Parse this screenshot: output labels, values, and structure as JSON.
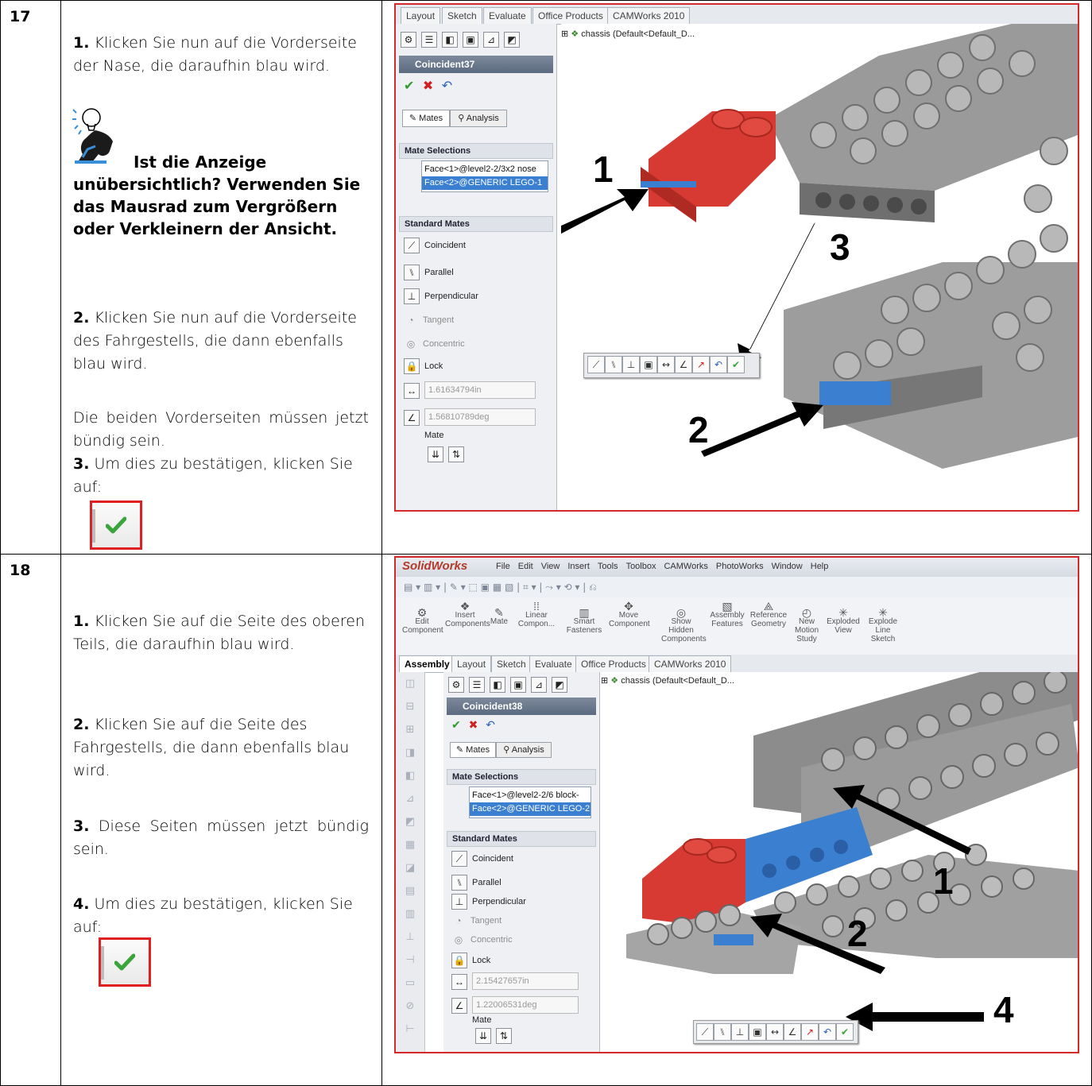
{
  "steps": [
    {
      "number": "17",
      "p1_num": "1.",
      "p1_text": " Klicken Sie nun auf die Vorderseite der Nase, die daraufhin blau wird.",
      "tip": "Ist die Anzeige unübersichtlich? Verwenden Sie das Mausrad zum Vergrößern oder Verkleinern der Ansicht.",
      "p2_num": "2.",
      "p2_text": " Klicken Sie nun auf die Vorderseite des Fahrgestells, die dann ebenfalls blau wird.",
      "p3_text": "Die beiden Vorderseiten müssen jetzt bündig sein.",
      "p4_num": "3.",
      "p4_text": " Um dies zu bestätigen, klicken Sie auf:"
    },
    {
      "number": "18",
      "p1_num": "1.",
      "p1_text": " Klicken Sie auf die Seite des oberen Teils, die daraufhin blau wird.",
      "p2_num": "2.",
      "p2_text": " Klicken Sie auf die Seite des Fahrgestells, die dann ebenfalls blau wird.",
      "p3_num": "3.",
      "p3_text": " Diese Seiten müssen jetzt bündig sein.",
      "p4_num": "4.",
      "p4_text": " Um dies zu bestätigen, klicken Sie auf:"
    }
  ],
  "shot1": {
    "tabs": [
      "Layout",
      "Sketch",
      "Evaluate",
      "Office Products",
      "CAMWorks 2010"
    ],
    "tree_label": "chassis (Default<Default_D...",
    "pm_title": "Coincident37",
    "tab_mates": "Mates",
    "tab_analysis": "Analysis",
    "mate_selections": "Mate Selections",
    "sel1": "Face<1>@level2-2/3x2 nose",
    "sel2": "Face<2>@GENERIC LEGO-1",
    "standard_mates": "Standard Mates",
    "coincident": "Coincident",
    "parallel": "Parallel",
    "perpendicular": "Perpendicular",
    "tangent": "Tangent",
    "concentric": "Concentric",
    "lock": "Lock",
    "distance": "1.61634794in",
    "angle": "1.56810789deg",
    "mate": "Mate",
    "callouts": [
      "1",
      "2",
      "3"
    ]
  },
  "shot2": {
    "app": "SolidWorks",
    "menu": [
      "File",
      "Edit",
      "View",
      "Insert",
      "Tools",
      "Toolbox",
      "CAMWorks",
      "PhotoWorks",
      "Window",
      "Help"
    ],
    "ribbon": [
      "Edit Component",
      "Insert Components",
      "Mate",
      "Linear Compon...",
      "Smart Fasteners",
      "Move Component",
      "Show Hidden Components",
      "Assembly Features",
      "Reference Geometry",
      "New Motion Study",
      "Exploded View",
      "Explode Line Sketch"
    ],
    "tabs": [
      "Assembly",
      "Layout",
      "Sketch",
      "Evaluate",
      "Office Products",
      "CAMWorks 2010"
    ],
    "tree_label": "chassis (Default<Default_D...",
    "pm_title": "Coincident38",
    "tab_mates": "Mates",
    "tab_analysis": "Analysis",
    "mate_selections": "Mate Selections",
    "sel1": "Face<1>@level2-2/6 block-",
    "sel2": "Face<2>@GENERIC LEGO-2",
    "standard_mates": "Standard Mates",
    "coincident": "Coincident",
    "parallel": "Parallel",
    "perpendicular": "Perpendicular",
    "tangent": "Tangent",
    "concentric": "Concentric",
    "lock": "Lock",
    "distance": "2.15427657in",
    "angle": "1.22006531deg",
    "mate": "Mate",
    "callouts": [
      "1",
      "2",
      "4"
    ]
  },
  "colors": {
    "highlight_red": "#d62a2a",
    "brick_red": "#d63a32",
    "brick_grey": "#8f8f8f",
    "select_blue": "#3b7fd1",
    "check_green": "#3aa53a"
  }
}
